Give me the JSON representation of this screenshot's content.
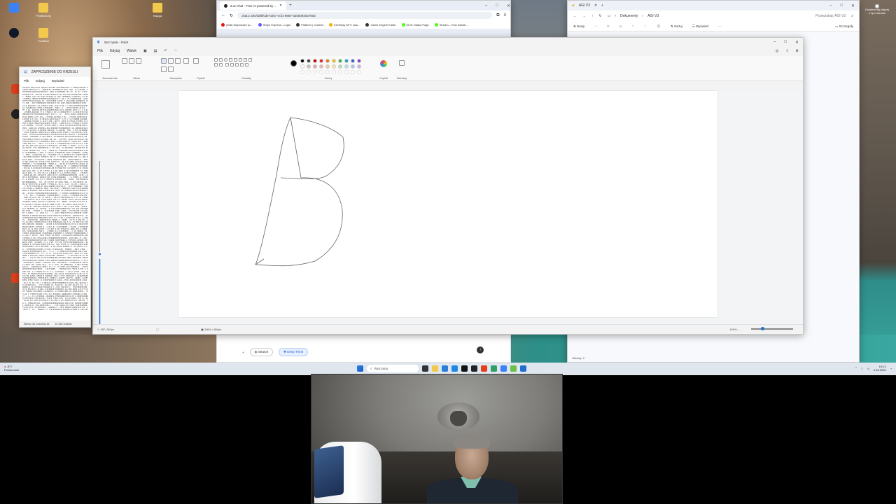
{
  "desktop": {
    "icons": [
      {
        "label": "",
        "color": "#3b82f6"
      },
      {
        "label": "PixelBull.zip",
        "color": "#f2c94c"
      },
      {
        "label": "Księga",
        "color": "#f2c94c"
      },
      {
        "label": "",
        "color": "#111827"
      },
      {
        "label": "PixelBull",
        "color": "#f2c94c"
      }
    ]
  },
  "browser": {
    "tab_title": "Z.ai Chat - Free AI powered by ...",
    "url": "chat.z.ai/c/5af5fcde-0257-4cf1-9867-a250092537602",
    "bookmarks": [
      "(546) Najnowsze pr...",
      "Stripe Express - Login",
      "Platform | ChatOn",
      "Interfejsy API i usłu...",
      "Game Engine Editor",
      "KICK Status Page",
      "Stream – Kick Dashb..."
    ]
  },
  "explorer": {
    "tab_title": "AGI V3",
    "path": [
      "Dokumenty",
      "AGI V3"
    ],
    "search_placeholder": "Przeszukaj: AGI V3",
    "toolbar": {
      "new": "Nowy",
      "sort": "Sortuj",
      "view": "Wyświetl",
      "more": "···",
      "details": "Szczegóły"
    },
    "status": "Obiekty: 0"
  },
  "notepad": {
    "title": "ZAPROSZENIE DO KRZESLI",
    "menu": [
      "Plik",
      "Edytuj",
      "Wyświetl"
    ],
    "status_position": "Wiersz 36, kolumna 45",
    "status_chars": "10 363 znaków"
  },
  "paint": {
    "title": "Bez tytułu - Paint",
    "menu": [
      "Plik",
      "Edytuj",
      "Widok"
    ],
    "groups": {
      "selection": "Zaznaczenie",
      "image": "Obraz",
      "tools": "Narzędzia",
      "brushes": "Pędzle",
      "shapes": "Kształty",
      "colors": "Kolory",
      "copilot": "Copilot",
      "layers": "Warstwy"
    },
    "colors": [
      "#000000",
      "#404040",
      "#c00000",
      "#e02020",
      "#f07020",
      "#f0c020",
      "#40b040",
      "#20a0d0",
      "#3060d0",
      "#8040c0",
      "#ffffff",
      "#c0c0c0",
      "#e8a0a0",
      "#f0b0b0",
      "#f0c8a0",
      "#f8e8a0",
      "#b0e0b0",
      "#b0e0f0",
      "#b0c0f0",
      "#d0b0e8"
    ],
    "status_cursor": "287, 667px",
    "status_size": "2064 × 864px",
    "zoom": "100%",
    "drawing_label": "B"
  },
  "chat": {
    "plus": "+",
    "search": "Search",
    "deep_think": "Deep Think"
  },
  "taskbar": {
    "weather_temp": "-8°C",
    "weather_desc": "Pochmurnie",
    "search_placeholder": "Wyszukaj",
    "time": "18:13",
    "date": "4.02.2026",
    "notification_line1": "Dowiedz się więcej",
    "notification_line2": "o tym obrazie"
  }
}
